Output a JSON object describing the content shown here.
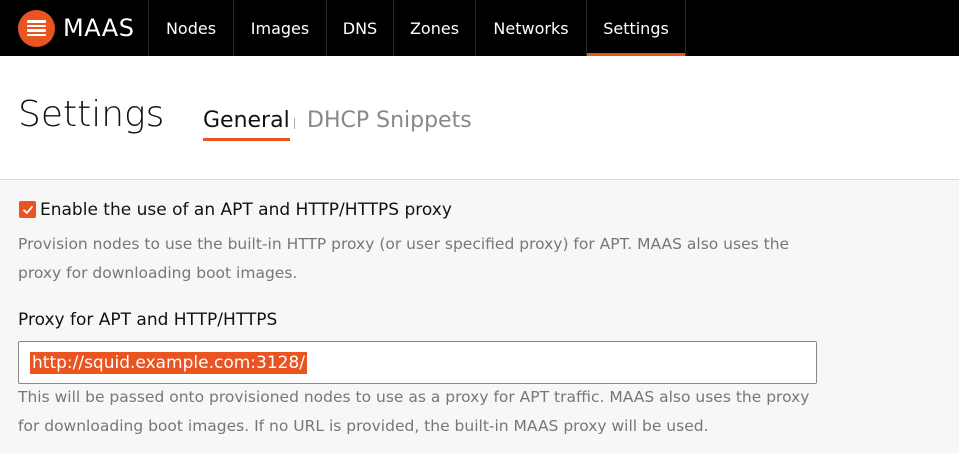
{
  "brand": {
    "name": "MAAS",
    "logo_icon": "maas-logo-icon"
  },
  "nav": {
    "items": [
      {
        "label": "Nodes"
      },
      {
        "label": "Images"
      },
      {
        "label": "DNS"
      },
      {
        "label": "Zones"
      },
      {
        "label": "Networks"
      },
      {
        "label": "Settings"
      }
    ],
    "active": "Settings"
  },
  "header": {
    "title": "Settings",
    "tabs": [
      {
        "label": "General"
      },
      {
        "label": "DHCP Snippets"
      }
    ],
    "active_tab": "General"
  },
  "proxy_settings": {
    "enable_checkbox": {
      "label": "Enable the use of an APT and HTTP/HTTPS proxy",
      "checked": true
    },
    "enable_help": "Provision nodes to use the built-in HTTP proxy (or user specified proxy) for APT. MAAS also uses the proxy for downloading boot images.",
    "url_field": {
      "label": "Proxy for APT and HTTP/HTTPS",
      "value": "http://squid.example.com:3128/",
      "help": "This will be passed onto provisioned nodes to use as a proxy for APT traffic. MAAS also uses the proxy for downloading boot images. If no URL is provided, the built-in MAAS proxy will be used."
    }
  },
  "colors": {
    "accent": "#e95420",
    "nav_bg": "#000000",
    "muted_text": "#777777"
  }
}
